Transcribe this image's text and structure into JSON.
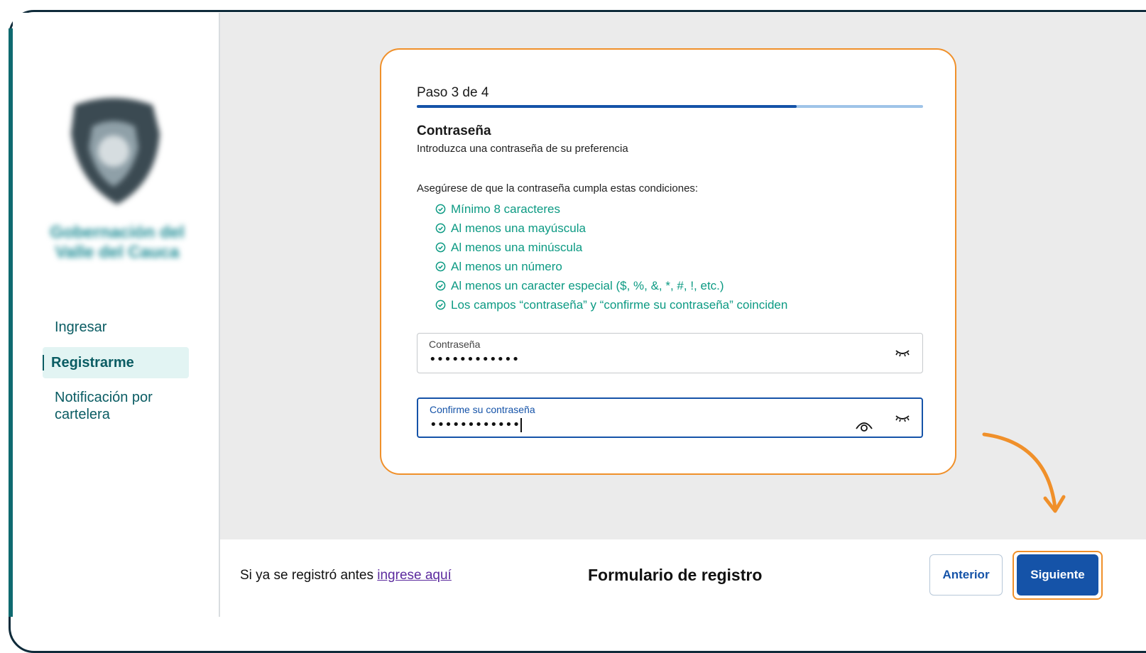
{
  "sidebar": {
    "logo_text": "Gobernación del Valle del Cauca",
    "items": [
      {
        "label": "Ingresar",
        "active": false
      },
      {
        "label": "Registrarme",
        "active": true
      },
      {
        "label": "Notificación por cartelera",
        "active": false
      }
    ]
  },
  "form": {
    "step_text": "Paso 3 de 4",
    "progress_fraction": 0.75,
    "section_title": "Contraseña",
    "section_subtitle": "Introduzca una contraseña de su preferencia",
    "conditions_intro": "Asegúrese de que la contraseña cumpla estas condiciones:",
    "conditions": [
      "Mínimo 8 caracteres",
      "Al menos una mayúscula",
      "Al menos una minúscula",
      "Al menos un número",
      "Al menos un caracter especial ($, %, &, *, #, !, etc.)",
      "Los campos “contraseña” y “confirme su contraseña” coinciden"
    ],
    "password": {
      "label": "Contraseña",
      "value": "••••••••••••"
    },
    "confirm": {
      "label": "Confirme su contraseña",
      "value": "••••••••••••"
    }
  },
  "footer": {
    "login_prefix": "Si ya se registró antes ",
    "login_link": "ingrese aquí",
    "title": "Formulario de registro",
    "prev_label": "Anterior",
    "next_label": "Siguiente"
  },
  "colors": {
    "accent_orange": "#f0902a",
    "primary_blue": "#1553a8",
    "success_green": "#0c9a83",
    "nav_teal": "#0a5c63"
  }
}
